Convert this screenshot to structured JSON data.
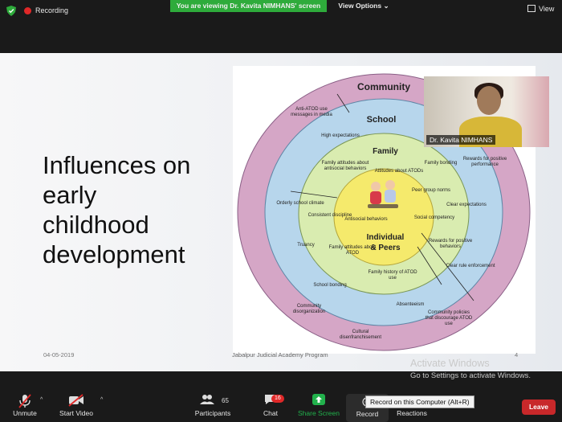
{
  "topbar": {
    "recording_label": "Recording",
    "viewing_banner": "You are viewing Dr. Kavita NIMHANS' screen",
    "view_options_label": "View Options",
    "view_label": "View"
  },
  "slide": {
    "title": "Influences on\nearly\nchildhood\ndevelopment",
    "date": "04-05-2019",
    "footer": "Jabalpur Judicial Academy Program",
    "page_number": "4"
  },
  "diagram": {
    "rings": {
      "community": "Community",
      "school": "School",
      "family": "Family",
      "individual": "Individual",
      "peers": "& Peers"
    },
    "community_labels": [
      "Anti-ATOD use messages in media",
      "Rewards for positive performance",
      "Orderly school climate",
      "Truancy",
      "Community disorganization",
      "Cultural disenfranchisement",
      "Community policies that discourage ATOD use"
    ],
    "school_labels": [
      "High expectations",
      "Family bonding",
      "Consistent discipline",
      "Clear expectations",
      "Family attitudes about ATOD",
      "Rewards for positive behaviors",
      "School bonding",
      "Clear rule enforcement",
      "Family history of ATOD use",
      "Absenteeism"
    ],
    "family_labels": [
      "Family attitudes about antisocial behaviors",
      "Attitudes about ATODs",
      "Peer group norms",
      "Antisocial behaviors",
      "Social competency"
    ]
  },
  "video": {
    "participant_name": "Dr. Kavita NIMHANS"
  },
  "watermark": {
    "line1": "Activate Windows",
    "line2": "Go to Settings to activate Windows."
  },
  "toolbar": {
    "unmute": "Unmute",
    "start_video": "Start Video",
    "participants": "Participants",
    "participants_count": "65",
    "chat": "Chat",
    "chat_badge": "16",
    "share_screen": "Share Screen",
    "record": "Record",
    "record_tooltip": "Record on this Computer (Alt+R)",
    "reactions": "Reactions",
    "leave": "Leave"
  },
  "colors": {
    "community_ring": "#d5a6c6",
    "school_ring": "#b7d6ec",
    "family_ring": "#d9ecb0",
    "individual_core": "#f5ea6c",
    "share_green": "#22b14c",
    "leave_red": "#c8282a",
    "banner_green": "#2eab3b"
  }
}
